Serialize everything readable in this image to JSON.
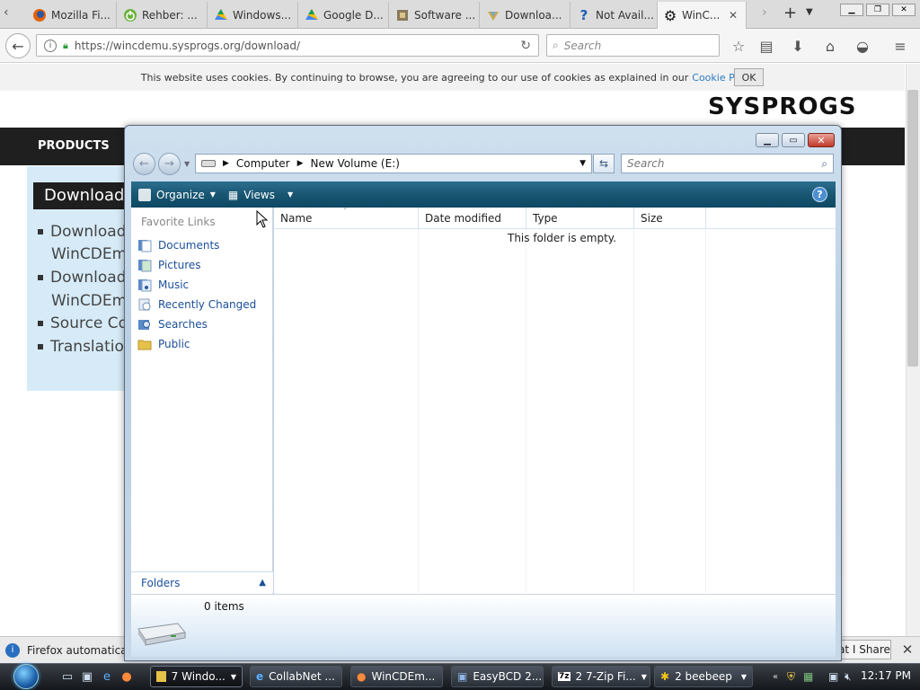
{
  "browser": {
    "tabs": [
      {
        "label": "Mozilla Fi...",
        "icon": "firefox-icon"
      },
      {
        "label": "Rehber: ...",
        "icon": "power-icon"
      },
      {
        "label": "Windows...",
        "icon": "google-drive-icon"
      },
      {
        "label": "Google D...",
        "icon": "google-drive-icon"
      },
      {
        "label": "Software ...",
        "icon": "software-icon"
      },
      {
        "label": "Downloa...",
        "icon": "download-site-icon"
      },
      {
        "label": "Not Avail...",
        "icon": "question-icon"
      },
      {
        "label": "WinC...",
        "icon": "gear-icon"
      }
    ],
    "url": "https://wincdemu.sysprogs.org/download/",
    "search_placeholder": "Search"
  },
  "page": {
    "cookie_text": "This website uses cookies. By continuing to browse, you are agreeing to our use of cookies as explained in our",
    "cookie_link": "Cookie Policy",
    "cookie_period": ".",
    "ok_label": "OK",
    "logo": "SYSPROGS",
    "nav_products": "PRODUCTS",
    "download_heading": "Download",
    "side_items": [
      "Download",
      "WinCDEmu",
      "Download",
      "WinCDEmu",
      "Source Co",
      "Translatio"
    ],
    "notification": "Firefox automatically",
    "share_label": "at I Share"
  },
  "explorer": {
    "address": {
      "segment1": "Computer",
      "segment2": "New Volume (E:)"
    },
    "search_placeholder": "Search",
    "toolbar": {
      "organize": "Organize",
      "views": "Views"
    },
    "favorites_heading": "Favorite Links",
    "favorites": [
      "Documents",
      "Pictures",
      "Music",
      "Recently Changed",
      "Searches",
      "Public"
    ],
    "folders_label": "Folders",
    "columns": [
      "Name",
      "Date modified",
      "Type",
      "Size"
    ],
    "empty_message": "This folder is empty.",
    "item_count": "0 items"
  },
  "taskbar": {
    "tasks": [
      {
        "label": "7 Windo...",
        "icon": "folder-icon"
      },
      {
        "label": "CollabNet ...",
        "icon": "ie-icon"
      },
      {
        "label": "WinCDEm...",
        "icon": "firefox-icon"
      },
      {
        "label": "EasyBCD 2....",
        "icon": "easybcd-icon"
      },
      {
        "label": "2 7-Zip Fi...",
        "icon": "7zip-icon"
      },
      {
        "label": "2 beebeep",
        "icon": "bee-icon"
      }
    ],
    "clock": "12:17 PM"
  }
}
